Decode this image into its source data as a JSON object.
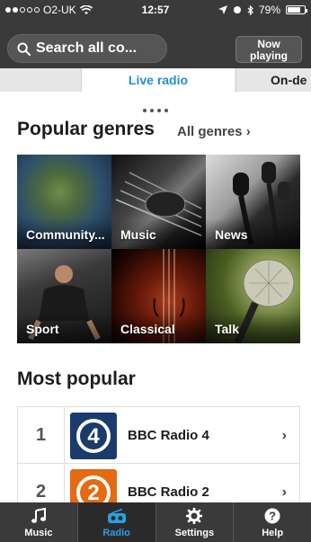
{
  "status_bar": {
    "carrier": "O2-UK",
    "time": "12:57",
    "battery": "79%",
    "battery_level": 0.79
  },
  "header": {
    "search_text": "Search all co...",
    "now_playing_line1": "Now",
    "now_playing_line2": "playing"
  },
  "tabs": {
    "active": "Live radio",
    "next": "On-de"
  },
  "genres": {
    "title": "Popular genres",
    "all_link": "All genres",
    "items": [
      {
        "label": "Community..."
      },
      {
        "label": "Music"
      },
      {
        "label": "News"
      },
      {
        "label": "Sport"
      },
      {
        "label": "Classical"
      },
      {
        "label": "Talk"
      }
    ]
  },
  "most_popular": {
    "title": "Most popular",
    "items": [
      {
        "rank": "1",
        "name": "BBC Radio 4",
        "logo_number": "4",
        "logo_color": "#1a3b6b"
      },
      {
        "rank": "2",
        "name": "BBC Radio 2",
        "logo_number": "2",
        "logo_color": "#e56a12"
      }
    ]
  },
  "bottom_nav": {
    "items": [
      {
        "label": "Music",
        "icon": "music-note-icon"
      },
      {
        "label": "Radio",
        "icon": "radio-icon"
      },
      {
        "label": "Settings",
        "icon": "gear-icon"
      },
      {
        "label": "Help",
        "icon": "help-icon"
      }
    ],
    "active": "Radio",
    "active_color": "#2aa0e0"
  },
  "colors": {
    "accent": "#1f8ed6",
    "header_bg": "#3a3a3a"
  }
}
